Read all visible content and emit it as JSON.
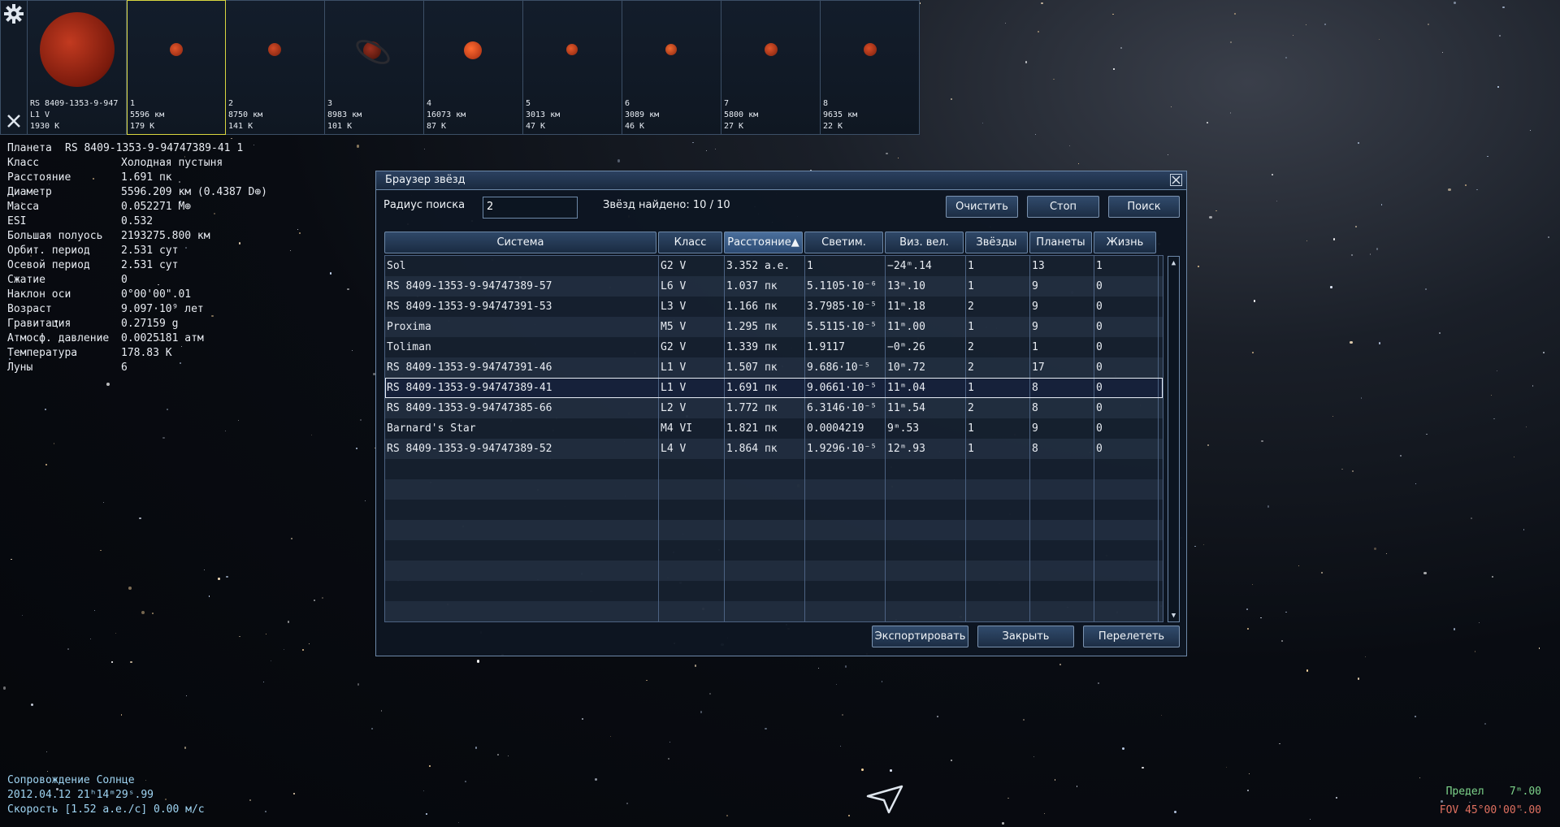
{
  "thumbnails": [
    {
      "name": "RS 8409-1353-9-947",
      "line2": "L1 V",
      "line3": "1930 K",
      "selected": false
    },
    {
      "name": "1",
      "line2": "5596 км",
      "line3": "179 K",
      "selected": true
    },
    {
      "name": "2",
      "line2": "8750 км",
      "line3": "141 K",
      "selected": false
    },
    {
      "name": "3",
      "line2": "8983 км",
      "line3": "101 K",
      "selected": false
    },
    {
      "name": "4",
      "line2": "16073 км",
      "line3": "87 K",
      "selected": false
    },
    {
      "name": "5",
      "line2": "3013 км",
      "line3": "47 K",
      "selected": false
    },
    {
      "name": "6",
      "line2": "3089 км",
      "line3": "46 K",
      "selected": false
    },
    {
      "name": "7",
      "line2": "5800 км",
      "line3": "27 K",
      "selected": false
    },
    {
      "name": "8",
      "line2": "9635 км",
      "line3": "22 K",
      "selected": false
    }
  ],
  "side_icons": {
    "settings": "gear-icon",
    "close": "close-icon"
  },
  "info": {
    "planet_label": "Планета",
    "planet_name": "RS 8409-1353-9-94747389-41 1",
    "rows": [
      {
        "k": "Класс",
        "v": "Холодная пустыня"
      },
      {
        "k": "Расстояние",
        "v": "1.691 пк"
      },
      {
        "k": "Диаметр",
        "v": "5596.209 км (0.4387 D⊕)"
      },
      {
        "k": "Масса",
        "v": "0.052271 M⊕"
      },
      {
        "k": "ESI",
        "v": "0.532"
      },
      {
        "k": "Большая полуось",
        "v": "2193275.800 км"
      },
      {
        "k": "Орбит. период",
        "v": "2.531 сут"
      },
      {
        "k": "Осевой период",
        "v": "2.531 сут"
      },
      {
        "k": "Сжатие",
        "v": "0"
      },
      {
        "k": "Наклон оси",
        "v": "0°00'00\".01"
      },
      {
        "k": "Возраст",
        "v": "9.097·10⁹ лет"
      },
      {
        "k": "Гравитация",
        "v": "0.27159 g"
      },
      {
        "k": "Атмосф. давление",
        "v": "0.0025181 атм"
      },
      {
        "k": "Температура",
        "v": "178.83 K"
      },
      {
        "k": "Луны",
        "v": "6"
      }
    ]
  },
  "dialog": {
    "title": "Браузер звёзд",
    "search_radius_label": "Радиус поиска",
    "search_radius_value": "2",
    "found_label": "Звёзд найдено: 10 / 10",
    "btn_clear": "Очистить",
    "btn_stop": "Стоп",
    "btn_search": "Поиск",
    "btn_export": "Экспортировать",
    "btn_close": "Закрыть",
    "btn_fly": "Перелететь",
    "columns": [
      "Система",
      "Класс",
      "Расстояние▲",
      "Светим.",
      "Виз. вел.",
      "Звёзды",
      "Планеты",
      "Жизнь"
    ],
    "rows": [
      [
        "Sol",
        "G2 V",
        "3.352 а.е.",
        "1",
        "−24ᵐ.14",
        "1",
        "13",
        "1"
      ],
      [
        "RS 8409-1353-9-94747389-57",
        "L6 V",
        "1.037 пк",
        "5.1105·10⁻⁶",
        "13ᵐ.10",
        "1",
        "9",
        "0"
      ],
      [
        "RS 8409-1353-9-94747391-53",
        "L3 V",
        "1.166 пк",
        "3.7985·10⁻⁵",
        "11ᵐ.18",
        "2",
        "9",
        "0"
      ],
      [
        "Proxima",
        "M5 V",
        "1.295 пк",
        "5.5115·10⁻⁵",
        "11ᵐ.00",
        "1",
        "9",
        "0"
      ],
      [
        "Toliman",
        "G2 V",
        "1.339 пк",
        "1.9117",
        "−0ᵐ.26",
        "2",
        "1",
        "0"
      ],
      [
        "RS 8409-1353-9-94747391-46",
        "L1 V",
        "1.507 пк",
        "9.686·10⁻⁵",
        "10ᵐ.72",
        "2",
        "17",
        "0"
      ],
      [
        "RS 8409-1353-9-94747389-41",
        "L1 V",
        "1.691 пк",
        "9.0661·10⁻⁵",
        "11ᵐ.04",
        "1",
        "8",
        "0"
      ],
      [
        "RS 8409-1353-9-94747385-66",
        "L2 V",
        "1.772 пк",
        "6.3146·10⁻⁵",
        "11ᵐ.54",
        "2",
        "8",
        "0"
      ],
      [
        "Barnard's Star",
        "M4 VI",
        "1.821 пк",
        "0.0004219",
        "9ᵐ.53",
        "1",
        "9",
        "0"
      ],
      [
        "RS 8409-1353-9-94747389-52",
        "L4 V",
        "1.864 пк",
        "1.9296·10⁻⁵",
        "12ᵐ.93",
        "1",
        "8",
        "0"
      ]
    ],
    "selected_row": 6
  },
  "status": {
    "follow": "Сопровождение Солнце",
    "datetime": "2012.04.12 21ʰ14ᵐ29ˢ.99",
    "speed": "Скорость [1.52 а.е./с] 0.00 м/с",
    "limit_label": "Предел",
    "limit_value": "7ᵐ.00",
    "fov_label": "FOV",
    "fov_value": "45°00'00\".00",
    "limit_color": "#7dd38a",
    "fov_color": "#e07060",
    "status_color": "#9fd4f2"
  }
}
